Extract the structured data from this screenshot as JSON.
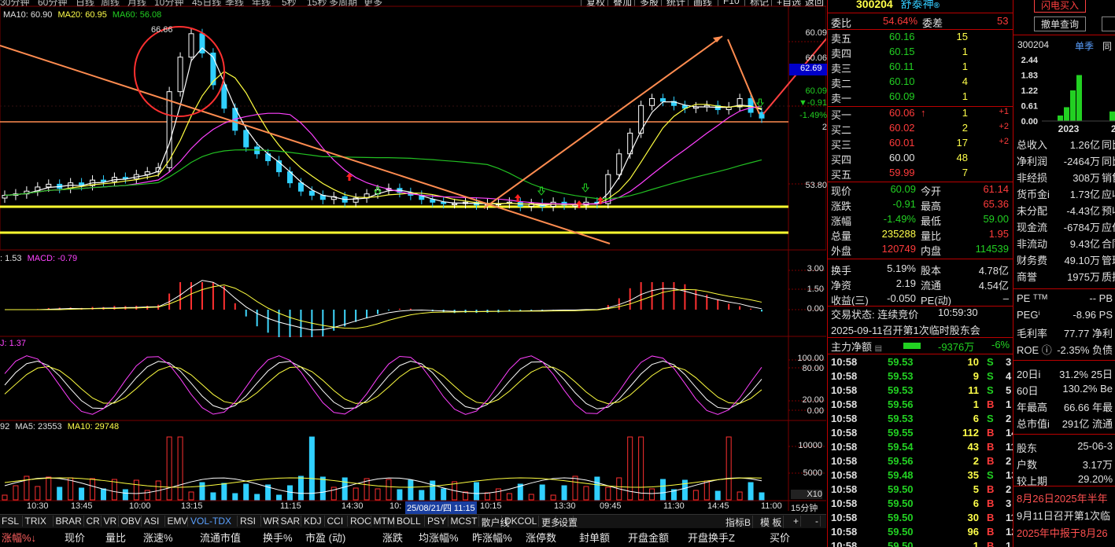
{
  "topbar": {
    "left": [
      "30分钟",
      "60分钟",
      "日线",
      "周线",
      "月线",
      "10分钟",
      "45日线",
      "季线",
      "年线",
      "5秒",
      "15秒",
      "多周期",
      "更多"
    ],
    "right": [
      "复权",
      "叠加",
      "多股",
      "统计",
      "画线",
      "F10",
      "标记",
      "+自选",
      "返回"
    ]
  },
  "legends": {
    "ma": {
      "ma10": "MA10: 60.90",
      "ma20": "MA20: 60.95",
      "ma60": "MA60: 56.08"
    },
    "macd": {
      "dea": ": 1.53",
      "macd": "MACD: -0.79"
    },
    "kdj": {
      "j": "J: 1.37"
    },
    "vol": {
      "vol": "92",
      "ma5": "MA5: 23553",
      "ma10": "MA10: 29748"
    }
  },
  "chart": {
    "peak_label": "66.66",
    "axis_main": [
      "60.09",
      "60.06",
      "60.09",
      "▼-0.91",
      "-1.49%",
      "2",
      "53.80"
    ],
    "axis_macd": [
      "3.00",
      "1.50",
      "0.00"
    ],
    "axis_kdj": [
      "100.00",
      "80.00",
      "20.00",
      "0.00"
    ],
    "axis_vol": [
      "10000",
      "5000",
      "X10"
    ],
    "price_tag": "62.69",
    "x_labels": [
      "10:30",
      "13:45",
      "10:00",
      "13:15",
      "11:15",
      "14:30",
      "10:",
      "10:15",
      "13:30",
      "09:45",
      "11:30",
      "14:45",
      "11:00",
      "15分钟"
    ],
    "date_tag": "25/08/21/四 11:15"
  },
  "bottombar": {
    "items": [
      "FSL",
      "TRIX",
      "BRAR",
      "CR",
      "VR",
      "OBV",
      "ASI",
      "EMV",
      "VOL-TDX",
      "RSI",
      "WR",
      "SAR",
      "KDJ",
      "CCI",
      "ROC",
      "MTM",
      "BOLL",
      "PSY",
      "MCST",
      "散户线",
      "DKCOL",
      "更多",
      "设置"
    ],
    "right": [
      "指标B",
      "模 板",
      "+",
      "-"
    ]
  },
  "colbar": [
    "涨幅%↓",
    "现价",
    "量比",
    "涨速%",
    "流通市值",
    "换手%",
    "市盈 (动)",
    "涨跌",
    "均涨幅%",
    "昨涨幅%",
    "涨停数",
    "封单额",
    "开盘金额",
    "开盘换手Z",
    "买价"
  ],
  "stock": {
    "code": "300204",
    "name": "舒泰神",
    "title_symbol": "®"
  },
  "weibi": {
    "label": "委比",
    "value": "54.64%",
    "diff_label": "委差",
    "diff": "53"
  },
  "sells": [
    {
      "label": "卖五",
      "price": "60.16",
      "vol": "15"
    },
    {
      "label": "卖四",
      "price": "60.15",
      "vol": "1"
    },
    {
      "label": "卖三",
      "price": "60.11",
      "vol": "1"
    },
    {
      "label": "卖二",
      "price": "60.10",
      "vol": "4"
    },
    {
      "label": "卖一",
      "price": "60.09",
      "vol": "1"
    }
  ],
  "buys": [
    {
      "label": "买一",
      "price": "60.06",
      "vol": "1",
      "chg": "+1"
    },
    {
      "label": "买二",
      "price": "60.02",
      "vol": "2",
      "chg": "+2"
    },
    {
      "label": "买三",
      "price": "60.01",
      "vol": "17",
      "chg": "+2"
    },
    {
      "label": "买四",
      "price": "60.00",
      "vol": "48",
      "chg": ""
    },
    {
      "label": "买五",
      "price": "59.99",
      "vol": "7",
      "chg": ""
    }
  ],
  "quote": [
    {
      "k1": "现价",
      "v1": "60.09",
      "k2": "今开",
      "v2": "61.14"
    },
    {
      "k1": "涨跌",
      "v1": "-0.91",
      "k2": "最高",
      "v2": "65.36"
    },
    {
      "k1": "涨幅",
      "v1": "-1.49%",
      "k2": "最低",
      "v2": "59.00"
    },
    {
      "k1": "总量",
      "v1": "235288",
      "k2": "量比",
      "v2": "1.95"
    },
    {
      "k1": "外盘",
      "v1": "120749",
      "k2": "内盘",
      "v2": "114539"
    },
    {
      "k1": "换手",
      "v1": "5.19%",
      "k2": "股本",
      "v2": "4.78亿"
    },
    {
      "k1": "净资",
      "v1": "2.19",
      "k2": "流通",
      "v2": "4.54亿"
    },
    {
      "k1": "收益(三)",
      "v1": "-0.050",
      "k2": "PE(动)",
      "v2": "–"
    }
  ],
  "status": {
    "label": "交易状态: 连续竞价",
    "time": "10:59:30"
  },
  "notice": "2025-09-11召开第1次临时股东会",
  "mainflow": {
    "label": "主力净额",
    "value": "-9376万",
    "pct": "-6%"
  },
  "ticks": [
    {
      "t": "10:58",
      "p": "59.53",
      "v": "10",
      "d": "S",
      "n": "3"
    },
    {
      "t": "10:58",
      "p": "59.53",
      "v": "9",
      "d": "S",
      "n": "4"
    },
    {
      "t": "10:58",
      "p": "59.53",
      "v": "11",
      "d": "S",
      "n": "5"
    },
    {
      "t": "10:58",
      "p": "59.56",
      "v": "1",
      "d": "B",
      "n": "1"
    },
    {
      "t": "10:58",
      "p": "59.53",
      "v": "6",
      "d": "S",
      "n": "2"
    },
    {
      "t": "10:58",
      "p": "59.55",
      "v": "112",
      "d": "B",
      "n": "14"
    },
    {
      "t": "10:58",
      "p": "59.54",
      "v": "43",
      "d": "B",
      "n": "11"
    },
    {
      "t": "10:58",
      "p": "59.56",
      "v": "2",
      "d": "B",
      "n": "2"
    },
    {
      "t": "10:58",
      "p": "59.48",
      "v": "35",
      "d": "S",
      "n": "13"
    },
    {
      "t": "10:58",
      "p": "59.50",
      "v": "5",
      "d": "B",
      "n": "2"
    },
    {
      "t": "10:58",
      "p": "59.50",
      "v": "6",
      "d": "B",
      "n": "3"
    },
    {
      "t": "10:58",
      "p": "59.50",
      "v": "30",
      "d": "B",
      "n": "11"
    },
    {
      "t": "10:58",
      "p": "59.50",
      "v": "96",
      "d": "B",
      "n": "12"
    },
    {
      "t": "10:58",
      "p": "59.50",
      "v": "1",
      "d": "B",
      "n": "1"
    }
  ],
  "finance": {
    "buttons": {
      "a": "闪电买入",
      "b": "撤单查询"
    },
    "code": "300204",
    "tab1": "单季",
    "tab2": "同",
    "yaxis": [
      "2.44",
      "1.83",
      "1.22",
      "0.61",
      "0.00"
    ],
    "years": [
      "2023",
      "202"
    ],
    "bars": [
      0.22,
      0.55,
      1.22,
      1.83,
      0.38
    ],
    "rows": [
      {
        "k": "总收入",
        "v": "1.26亿",
        "x": "同比"
      },
      {
        "k": "净利润",
        "v": "-2464万",
        "x": "同比"
      },
      {
        "k": "非经损",
        "v": "308万",
        "x": "销售"
      },
      {
        "k": "货币金i",
        "v": "1.73亿",
        "x": "应收"
      },
      {
        "k": "未分配",
        "v": "-4.43亿",
        "x": "预收"
      },
      {
        "k": "现金流",
        "v": "-6784万",
        "x": "应付"
      },
      {
        "k": "非流动",
        "v": "9.43亿",
        "x": "合同"
      },
      {
        "k": "财务费",
        "v": "49.10万",
        "x": "管理"
      },
      {
        "k": "商誉",
        "v": "1975万",
        "x": "质押"
      }
    ],
    "rows2": [
      {
        "k": "PE ᵀᵀᴹ",
        "v": "-- PB"
      },
      {
        "k": "PEGⁱ",
        "v": "-8.96 PS"
      },
      {
        "k": "毛利率",
        "v": "77.77 净利"
      },
      {
        "k": "ROE ⓘ",
        "v": "-2.35% 负债"
      },
      {
        "k": "20日i",
        "v": "31.2% 25日"
      },
      {
        "k": "60日",
        "v": "130.2% Be"
      },
      {
        "k": "年最高",
        "v": "66.66 年最"
      },
      {
        "k": "总市值i",
        "v": "291亿 流通"
      },
      {
        "k": "股东",
        "v": "25-06-3"
      },
      {
        "k": "户数",
        "v": "3.17万"
      },
      {
        "k": "较上期",
        "v": "29.20%"
      }
    ],
    "news": [
      "8月26日2025年半年",
      "9月11日召开第1次临",
      "2025年中报于8月26"
    ]
  }
}
